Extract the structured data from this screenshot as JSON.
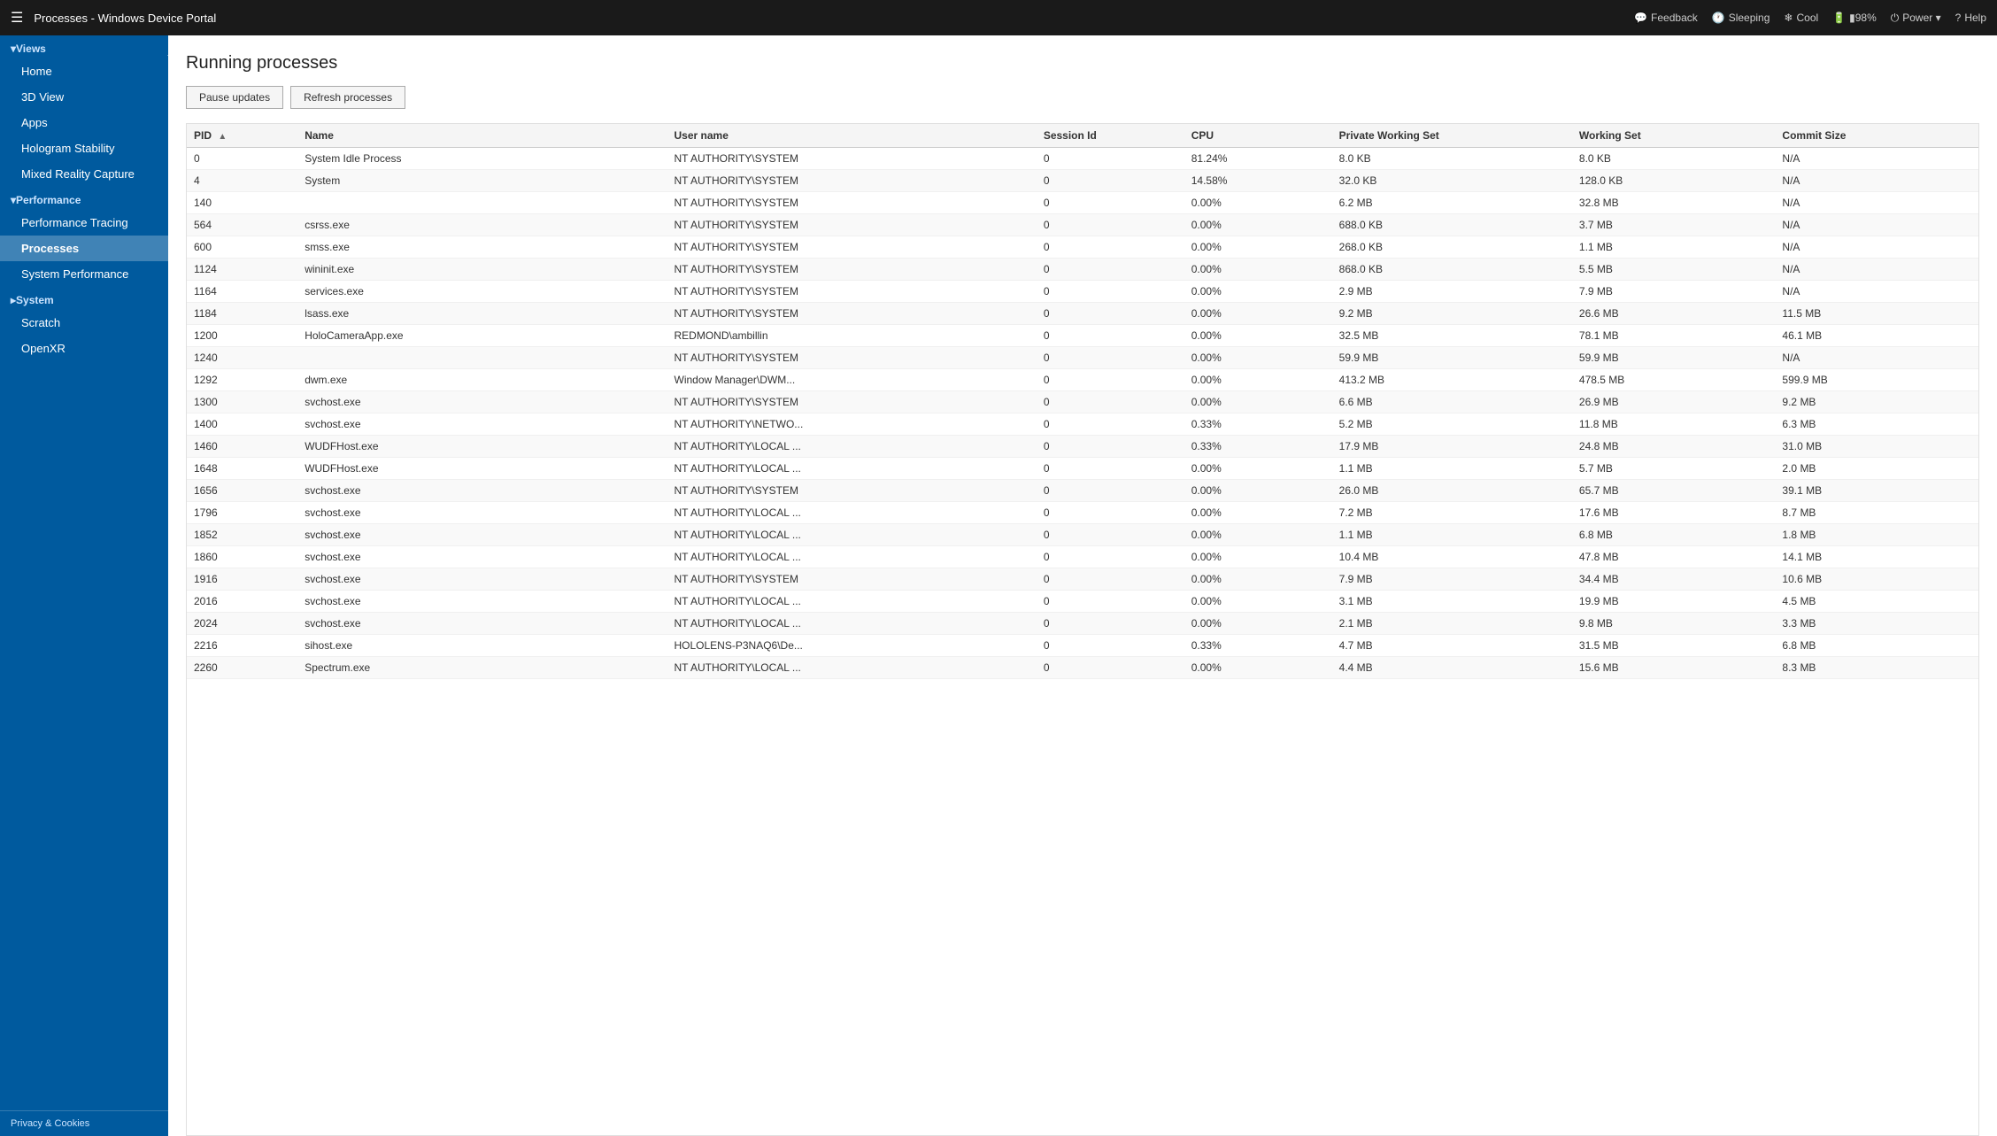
{
  "topbar": {
    "menu_icon": "☰",
    "title": "Processes - Windows Device Portal",
    "actions": [
      {
        "id": "feedback",
        "icon": "💬",
        "label": "Feedback"
      },
      {
        "id": "sleeping",
        "icon": "🕐",
        "label": "Sleeping"
      },
      {
        "id": "cool",
        "icon": "❄",
        "label": "Cool"
      },
      {
        "id": "battery",
        "icon": "🔋",
        "label": "▮98%"
      },
      {
        "id": "power",
        "icon": "⏻",
        "label": "Power ▾"
      },
      {
        "id": "help",
        "icon": "?",
        "label": "Help"
      }
    ]
  },
  "sidebar": {
    "collapse_icon": "◀",
    "sections": [
      {
        "id": "views",
        "label": "▾Views",
        "items": [
          {
            "id": "home",
            "label": "Home"
          },
          {
            "id": "3dview",
            "label": "3D View"
          },
          {
            "id": "apps",
            "label": "Apps"
          },
          {
            "id": "hologram-stability",
            "label": "Hologram Stability"
          },
          {
            "id": "mixed-reality-capture",
            "label": "Mixed Reality Capture"
          }
        ]
      },
      {
        "id": "performance",
        "label": "▾Performance",
        "items": [
          {
            "id": "performance-tracing",
            "label": "Performance Tracing"
          },
          {
            "id": "processes",
            "label": "Processes",
            "active": true
          },
          {
            "id": "system-performance",
            "label": "System Performance"
          }
        ]
      },
      {
        "id": "system",
        "label": "▸System",
        "items": []
      }
    ],
    "standalone_items": [
      {
        "id": "scratch",
        "label": "Scratch"
      },
      {
        "id": "openxr",
        "label": "OpenXR"
      }
    ],
    "footer": "Privacy & Cookies"
  },
  "page": {
    "title": "Running processes",
    "toolbar": {
      "pause_label": "Pause updates",
      "refresh_label": "Refresh processes"
    },
    "table": {
      "columns": [
        {
          "id": "pid",
          "label": "PID",
          "sort": true,
          "active_sort": true
        },
        {
          "id": "name",
          "label": "Name"
        },
        {
          "id": "username",
          "label": "User name"
        },
        {
          "id": "session",
          "label": "Session Id"
        },
        {
          "id": "cpu",
          "label": "CPU"
        },
        {
          "id": "private_working",
          "label": "Private Working Set"
        },
        {
          "id": "working_set",
          "label": "Working Set"
        },
        {
          "id": "commit_size",
          "label": "Commit Size"
        }
      ],
      "rows": [
        {
          "pid": "0",
          "name": "System Idle Process",
          "username": "NT AUTHORITY\\SYSTEM",
          "session": "0",
          "cpu": "81.24%",
          "private_working": "8.0 KB",
          "working_set": "8.0 KB",
          "commit_size": "N/A"
        },
        {
          "pid": "4",
          "name": "System",
          "username": "NT AUTHORITY\\SYSTEM",
          "session": "0",
          "cpu": "14.58%",
          "private_working": "32.0 KB",
          "working_set": "128.0 KB",
          "commit_size": "N/A"
        },
        {
          "pid": "140",
          "name": "",
          "username": "NT AUTHORITY\\SYSTEM",
          "session": "0",
          "cpu": "0.00%",
          "private_working": "6.2 MB",
          "working_set": "32.8 MB",
          "commit_size": "N/A"
        },
        {
          "pid": "564",
          "name": "csrss.exe",
          "username": "NT AUTHORITY\\SYSTEM",
          "session": "0",
          "cpu": "0.00%",
          "private_working": "688.0 KB",
          "working_set": "3.7 MB",
          "commit_size": "N/A"
        },
        {
          "pid": "600",
          "name": "smss.exe",
          "username": "NT AUTHORITY\\SYSTEM",
          "session": "0",
          "cpu": "0.00%",
          "private_working": "268.0 KB",
          "working_set": "1.1 MB",
          "commit_size": "N/A"
        },
        {
          "pid": "1124",
          "name": "wininit.exe",
          "username": "NT AUTHORITY\\SYSTEM",
          "session": "0",
          "cpu": "0.00%",
          "private_working": "868.0 KB",
          "working_set": "5.5 MB",
          "commit_size": "N/A"
        },
        {
          "pid": "1164",
          "name": "services.exe",
          "username": "NT AUTHORITY\\SYSTEM",
          "session": "0",
          "cpu": "0.00%",
          "private_working": "2.9 MB",
          "working_set": "7.9 MB",
          "commit_size": "N/A"
        },
        {
          "pid": "1184",
          "name": "lsass.exe",
          "username": "NT AUTHORITY\\SYSTEM",
          "session": "0",
          "cpu": "0.00%",
          "private_working": "9.2 MB",
          "working_set": "26.6 MB",
          "commit_size": "11.5 MB"
        },
        {
          "pid": "1200",
          "name": "HoloCameraApp.exe",
          "username": "REDMOND\\ambillin",
          "session": "0",
          "cpu": "0.00%",
          "private_working": "32.5 MB",
          "working_set": "78.1 MB",
          "commit_size": "46.1 MB"
        },
        {
          "pid": "1240",
          "name": "",
          "username": "NT AUTHORITY\\SYSTEM",
          "session": "0",
          "cpu": "0.00%",
          "private_working": "59.9 MB",
          "working_set": "59.9 MB",
          "commit_size": "N/A"
        },
        {
          "pid": "1292",
          "name": "dwm.exe",
          "username": "Window Manager\\DWM...",
          "session": "0",
          "cpu": "0.00%",
          "private_working": "413.2 MB",
          "working_set": "478.5 MB",
          "commit_size": "599.9 MB"
        },
        {
          "pid": "1300",
          "name": "svchost.exe",
          "username": "NT AUTHORITY\\SYSTEM",
          "session": "0",
          "cpu": "0.00%",
          "private_working": "6.6 MB",
          "working_set": "26.9 MB",
          "commit_size": "9.2 MB"
        },
        {
          "pid": "1400",
          "name": "svchost.exe",
          "username": "NT AUTHORITY\\NETWO...",
          "session": "0",
          "cpu": "0.33%",
          "private_working": "5.2 MB",
          "working_set": "11.8 MB",
          "commit_size": "6.3 MB"
        },
        {
          "pid": "1460",
          "name": "WUDFHost.exe",
          "username": "NT AUTHORITY\\LOCAL ...",
          "session": "0",
          "cpu": "0.33%",
          "private_working": "17.9 MB",
          "working_set": "24.8 MB",
          "commit_size": "31.0 MB"
        },
        {
          "pid": "1648",
          "name": "WUDFHost.exe",
          "username": "NT AUTHORITY\\LOCAL ...",
          "session": "0",
          "cpu": "0.00%",
          "private_working": "1.1 MB",
          "working_set": "5.7 MB",
          "commit_size": "2.0 MB"
        },
        {
          "pid": "1656",
          "name": "svchost.exe",
          "username": "NT AUTHORITY\\SYSTEM",
          "session": "0",
          "cpu": "0.00%",
          "private_working": "26.0 MB",
          "working_set": "65.7 MB",
          "commit_size": "39.1 MB"
        },
        {
          "pid": "1796",
          "name": "svchost.exe",
          "username": "NT AUTHORITY\\LOCAL ...",
          "session": "0",
          "cpu": "0.00%",
          "private_working": "7.2 MB",
          "working_set": "17.6 MB",
          "commit_size": "8.7 MB"
        },
        {
          "pid": "1852",
          "name": "svchost.exe",
          "username": "NT AUTHORITY\\LOCAL ...",
          "session": "0",
          "cpu": "0.00%",
          "private_working": "1.1 MB",
          "working_set": "6.8 MB",
          "commit_size": "1.8 MB"
        },
        {
          "pid": "1860",
          "name": "svchost.exe",
          "username": "NT AUTHORITY\\LOCAL ...",
          "session": "0",
          "cpu": "0.00%",
          "private_working": "10.4 MB",
          "working_set": "47.8 MB",
          "commit_size": "14.1 MB"
        },
        {
          "pid": "1916",
          "name": "svchost.exe",
          "username": "NT AUTHORITY\\SYSTEM",
          "session": "0",
          "cpu": "0.00%",
          "private_working": "7.9 MB",
          "working_set": "34.4 MB",
          "commit_size": "10.6 MB"
        },
        {
          "pid": "2016",
          "name": "svchost.exe",
          "username": "NT AUTHORITY\\LOCAL ...",
          "session": "0",
          "cpu": "0.00%",
          "private_working": "3.1 MB",
          "working_set": "19.9 MB",
          "commit_size": "4.5 MB"
        },
        {
          "pid": "2024",
          "name": "svchost.exe",
          "username": "NT AUTHORITY\\LOCAL ...",
          "session": "0",
          "cpu": "0.00%",
          "private_working": "2.1 MB",
          "working_set": "9.8 MB",
          "commit_size": "3.3 MB"
        },
        {
          "pid": "2216",
          "name": "sihost.exe",
          "username": "HOLOLENS-P3NAQ6\\De...",
          "session": "0",
          "cpu": "0.33%",
          "private_working": "4.7 MB",
          "working_set": "31.5 MB",
          "commit_size": "6.8 MB"
        },
        {
          "pid": "2260",
          "name": "Spectrum.exe",
          "username": "NT AUTHORITY\\LOCAL ...",
          "session": "0",
          "cpu": "0.00%",
          "private_working": "4.4 MB",
          "working_set": "15.6 MB",
          "commit_size": "8.3 MB"
        }
      ]
    }
  }
}
